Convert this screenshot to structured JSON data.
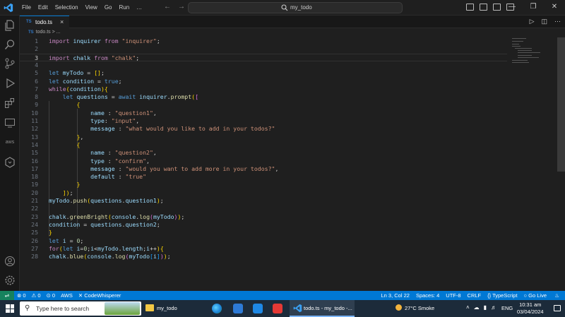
{
  "menu": [
    "File",
    "Edit",
    "Selection",
    "View",
    "Go",
    "Run",
    "…"
  ],
  "search": {
    "text": "my_todo"
  },
  "tab": {
    "badge": "TS",
    "name": "todo.ts",
    "close": "×"
  },
  "breadcrumb": {
    "badge": "TS",
    "text": "todo.ts > ..."
  },
  "editor": {
    "active_line": 3
  },
  "code_lines": [
    "import inquirer from \"inquirer\";",
    "",
    "import chalk from \"chalk\";",
    "",
    "let myTodo = [];",
    "let condition = true;",
    "while(condition){",
    "    let questions = await inquirer.prompt([",
    "        {",
    "            name : \"question1\",",
    "            type: \"input\",",
    "            message : \"what would you like to add in your todos?\"",
    "        },",
    "        {",
    "            name : \"question2\",",
    "            type : \"confirm\",",
    "            message : \"would you want to add more in your todos?\",",
    "            default : \"true\"",
    "        }",
    "    ]);",
    "myTodo.push(questions.question1);",
    "",
    "chalk.greenBright(console.log(myTodo));",
    "condition = questions.question2;",
    "}",
    "let i = 0;",
    "for(let i=0;i<myTodo.length;i++){",
    "chalk.blue(console.log(myTodo[i]));"
  ],
  "statusbar": {
    "errors": "⊗ 0",
    "warnings": "⚠ 0",
    "ports": "⊙ 0",
    "aws": "AWS",
    "codewhisperer": "✕ CodeWhisperer",
    "position": "Ln 3, Col 22",
    "spaces": "Spaces: 4",
    "encoding": "UTF-8",
    "eol": "CRLF",
    "language": "{} TypeScript",
    "golive": "○ Go Live"
  },
  "taskbar": {
    "search_placeholder": "Type here to search",
    "folder_label": "my_todo",
    "vscode_label": "todo.ts - my_todo -...",
    "weather": "27°C  Smoke",
    "language": "ENG",
    "time": "10:31 am",
    "date": "03/04/2024"
  },
  "colors": {
    "accent": "#0078d4",
    "keyword": "#569cd6",
    "string": "#ce9178",
    "function": "#dcdcaa",
    "variable": "#9cdcfe"
  }
}
